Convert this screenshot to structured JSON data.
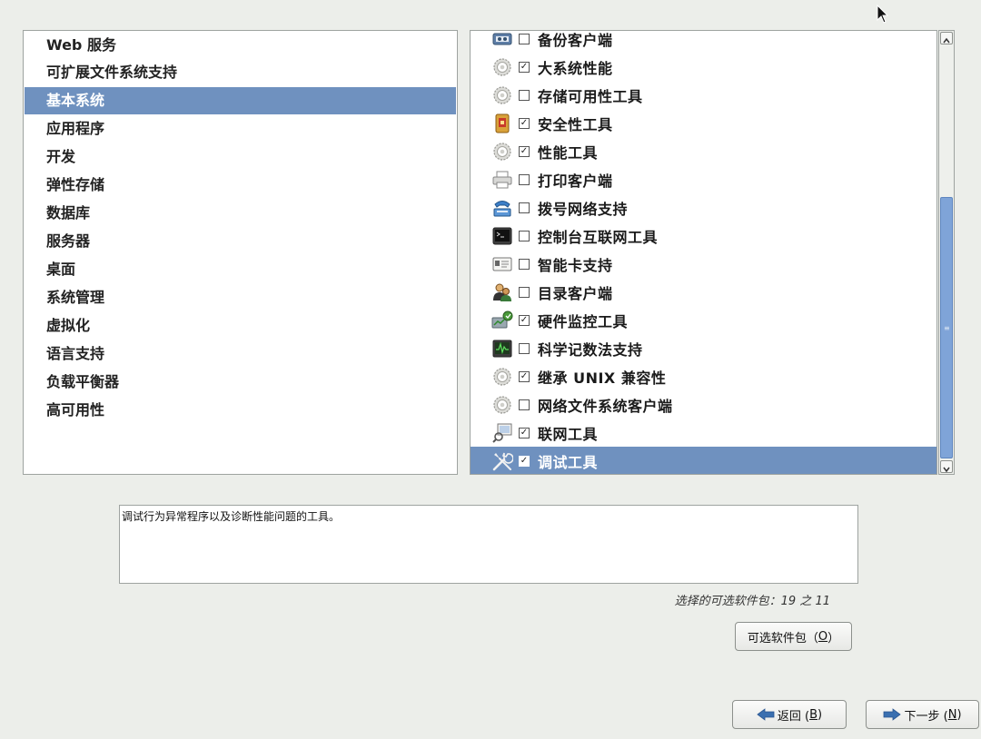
{
  "groups": [
    {
      "label": "Web 服务"
    },
    {
      "label": "可扩展文件系统支持"
    },
    {
      "label": "基本系统",
      "selected": true
    },
    {
      "label": "应用程序"
    },
    {
      "label": "开发"
    },
    {
      "label": "弹性存储"
    },
    {
      "label": "数据库"
    },
    {
      "label": "服务器"
    },
    {
      "label": "桌面"
    },
    {
      "label": "系统管理"
    },
    {
      "label": "虚拟化"
    },
    {
      "label": "语言支持"
    },
    {
      "label": "负载平衡器"
    },
    {
      "label": "高可用性"
    }
  ],
  "packages": [
    {
      "label": "备份客户端",
      "checked": false,
      "icon": "tape-backup-icon"
    },
    {
      "label": "大系统性能",
      "checked": true,
      "icon": "gear-icon"
    },
    {
      "label": "存储可用性工具",
      "checked": false,
      "icon": "gear-icon"
    },
    {
      "label": "安全性工具",
      "checked": true,
      "icon": "security-shield-icon"
    },
    {
      "label": "性能工具",
      "checked": true,
      "icon": "gear-icon"
    },
    {
      "label": "打印客户端",
      "checked": false,
      "icon": "printer-icon"
    },
    {
      "label": "拨号网络支持",
      "checked": false,
      "icon": "modem-phone-icon"
    },
    {
      "label": "控制台互联网工具",
      "checked": false,
      "icon": "terminal-icon"
    },
    {
      "label": "智能卡支持",
      "checked": false,
      "icon": "smart-card-icon"
    },
    {
      "label": "目录客户端",
      "checked": false,
      "icon": "directory-users-icon"
    },
    {
      "label": "硬件监控工具",
      "checked": true,
      "icon": "hardware-monitor-icon"
    },
    {
      "label": "科学记数法支持",
      "checked": false,
      "icon": "scientific-monitor-icon"
    },
    {
      "label": "继承 UNIX 兼容性",
      "checked": true,
      "icon": "gear-icon"
    },
    {
      "label": "网络文件系统客户端",
      "checked": false,
      "icon": "gear-icon"
    },
    {
      "label": "联网工具",
      "checked": true,
      "icon": "network-tools-icon"
    },
    {
      "label": "调试工具",
      "checked": true,
      "icon": "wrench-screwdriver-icon",
      "selected": true
    }
  ],
  "check_mark": "☑",
  "description": "调试行为异常程序以及诊断性能问题的工具。",
  "selection_count": {
    "prefix": "选择的可选软件包：",
    "text": "19 之 11"
  },
  "optional_button": {
    "label": "可选软件包（",
    "key": "O",
    "suffix": "）"
  },
  "back_button": {
    "label": "返回 (",
    "key": "B",
    "suffix": ")"
  },
  "next_button": {
    "label": "下一步 (",
    "key": "N",
    "suffix": ")"
  },
  "scrollbar": {
    "position_fraction": 0.46
  },
  "colors": {
    "selection": "#6f91bf",
    "arrow": "#3a6fb0"
  }
}
